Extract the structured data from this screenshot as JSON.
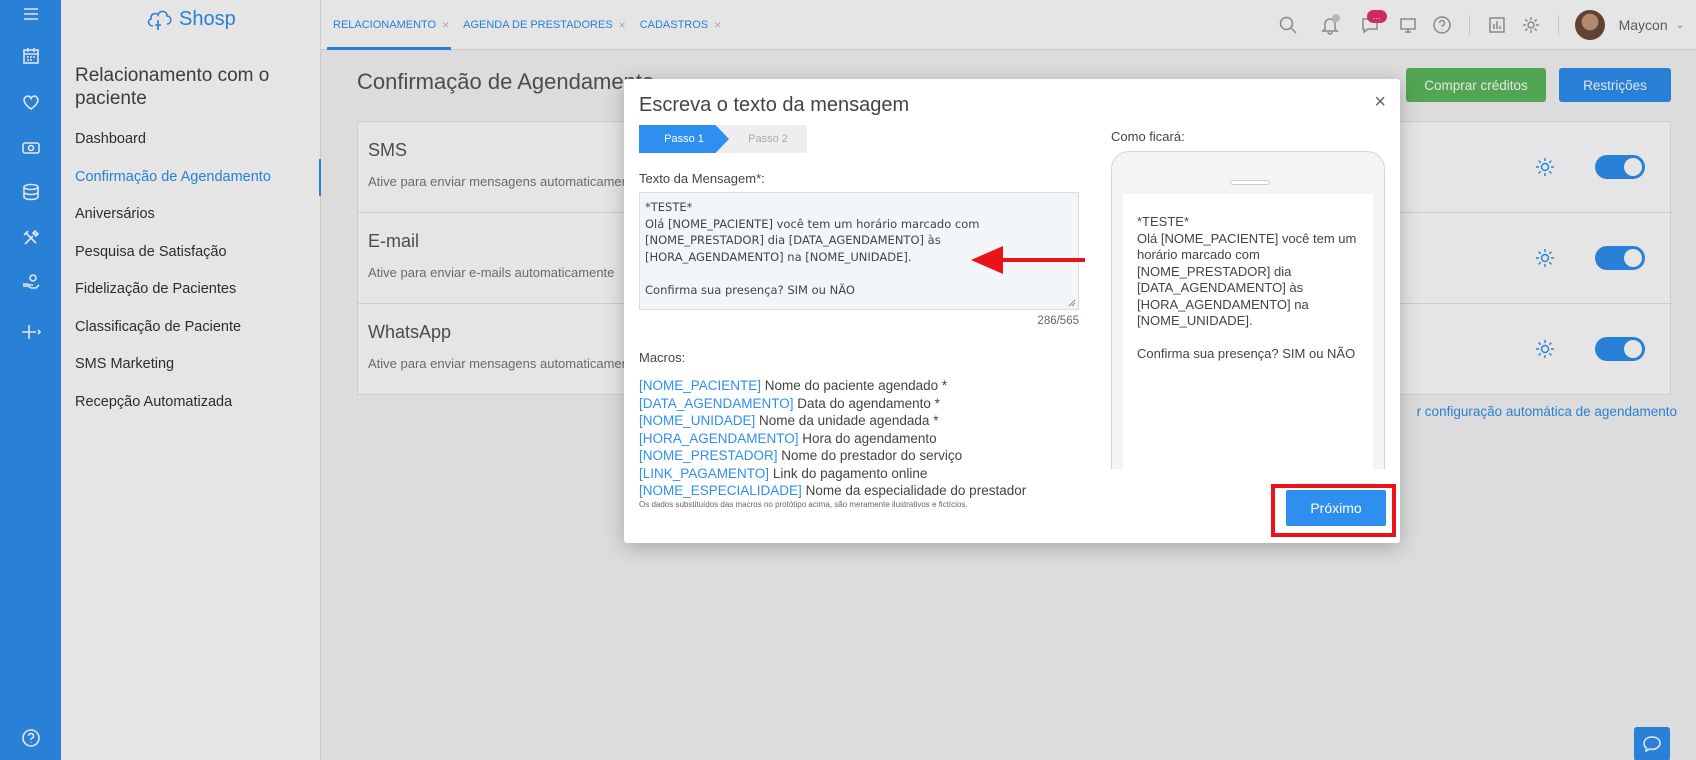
{
  "app": {
    "logo_text": "Shosp"
  },
  "rail": {
    "icons": [
      "menu-icon",
      "calendar-icon",
      "heart-icon",
      "money-icon",
      "database-icon",
      "tools-icon",
      "hand-icon",
      "plus-icon",
      "help-icon"
    ]
  },
  "sidebar": {
    "title": "Relacionamento com o paciente",
    "items": [
      {
        "label": "Dashboard"
      },
      {
        "label": "Confirmação de Agendamento"
      },
      {
        "label": "Aniversários"
      },
      {
        "label": "Pesquisa de Satisfação"
      },
      {
        "label": "Fidelização de Pacientes"
      },
      {
        "label": "Classificação de Paciente"
      },
      {
        "label": "SMS Marketing"
      },
      {
        "label": "Recepção Automatizada"
      }
    ]
  },
  "topbar": {
    "tabs": [
      {
        "label": "RELACIONAMENTO"
      },
      {
        "label": "AGENDA DE PRESTADORES"
      },
      {
        "label": "CADASTROS"
      }
    ],
    "chat_badge": "...",
    "user_name": "Maycon"
  },
  "main": {
    "title": "Confirmação de Agendamento",
    "buy_credits": "Comprar créditos",
    "restrictions": "Restrições",
    "channels": [
      {
        "name": "SMS",
        "desc": "Ative para enviar mensagens automaticamente"
      },
      {
        "name": "E-mail",
        "desc": "Ative para enviar e-mails automaticamente"
      },
      {
        "name": "WhatsApp",
        "desc": "Ative para enviar mensagens automaticamente"
      }
    ],
    "config_link": "r configuração automática de agendamento"
  },
  "modal": {
    "title": "Escreva o texto da mensagem",
    "close": "×",
    "step1": "Passo 1",
    "step2": "Passo 2",
    "message_label": "Texto da Mensagem*:",
    "message_text": "*TESTE*\nOlá [NOME_PACIENTE] você tem um horário marcado com\n[NOME_PRESTADOR] dia [DATA_AGENDAMENTO] às\n[HORA_AGENDAMENTO] na [NOME_UNIDADE].\n\nConfirma sua presença? SIM ou NÃO",
    "counter": "286/565",
    "macros_label": "Macros:",
    "macros": [
      {
        "key": "[NOME_PACIENTE]",
        "desc": "Nome do paciente agendado *"
      },
      {
        "key": "[DATA_AGENDAMENTO]",
        "desc": "Data do agendamento *"
      },
      {
        "key": "[NOME_UNIDADE]",
        "desc": "Nome da unidade agendada *"
      },
      {
        "key": "[HORA_AGENDAMENTO]",
        "desc": "Hora do agendamento"
      },
      {
        "key": "[NOME_PRESTADOR]",
        "desc": "Nome do prestador do serviço"
      },
      {
        "key": "[LINK_PAGAMENTO]",
        "desc": "Link do pagamento online"
      },
      {
        "key": "[NOME_ESPECIALIDADE]",
        "desc": "Nome da especialidade do prestador"
      }
    ],
    "footnote": "Os dados substituídos das macros no protótipo acima, são meramente ilustrativos e fictícios.",
    "preview_label": "Como ficará:",
    "preview_text": "*TESTE*\nOlá [NOME_PACIENTE] você tem um\nhorário marcado com\n[NOME_PRESTADOR] dia\n[DATA_AGENDAMENTO] às\n[HORA_AGENDAMENTO] na\n[NOME_UNIDADE].\n\nConfirma sua presença? SIM ou NÃO",
    "next_button": "Próximo"
  },
  "annotations": {
    "highlight_color": "#e8141a"
  }
}
